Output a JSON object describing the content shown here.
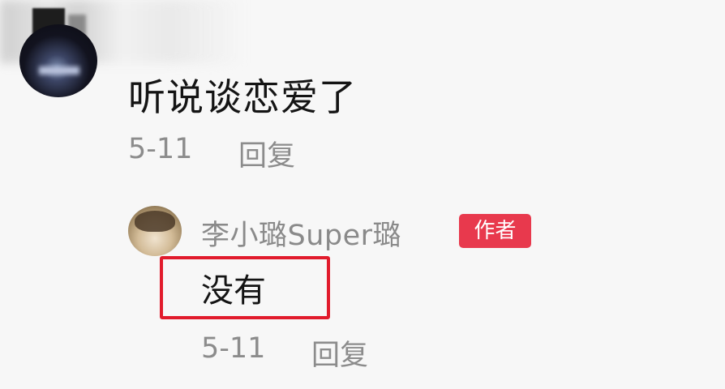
{
  "first_comment": {
    "text": "听说谈恋爱了",
    "date": "5-11",
    "reply_label": "回复"
  },
  "reply_comment": {
    "username": "李小璐Super璐",
    "badge": "作者",
    "text": "没有",
    "date": "5-11",
    "reply_label": "回复"
  },
  "colors": {
    "badge_bg": "#e8394d",
    "highlight_border": "#e11b2c",
    "meta_text": "#8c8c8c"
  }
}
